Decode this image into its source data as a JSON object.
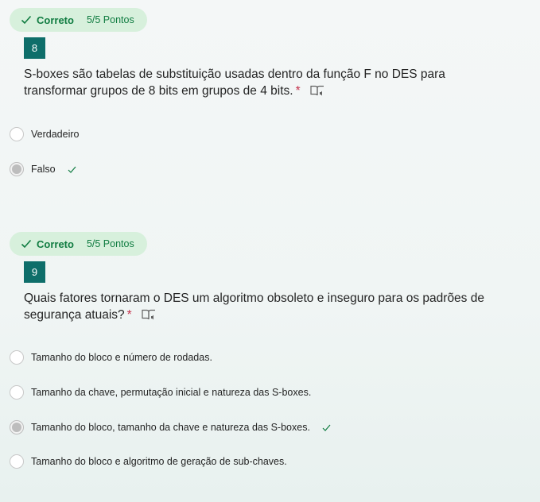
{
  "questions": [
    {
      "status": "Correto",
      "points": "5/5 Pontos",
      "number": "8",
      "text": "S-boxes são tabelas de substituição usadas dentro da função F no DES para transformar grupos de 8 bits em grupos de 4 bits.",
      "required_mark": "*",
      "options": [
        {
          "label": "Verdadeiro",
          "selected": false,
          "correct": false
        },
        {
          "label": "Falso",
          "selected": true,
          "correct": true
        }
      ]
    },
    {
      "status": "Correto",
      "points": "5/5 Pontos",
      "number": "9",
      "text": "Quais fatores tornaram o DES um algoritmo obsoleto e inseguro para os padrões de segurança atuais?",
      "required_mark": "*",
      "options": [
        {
          "label": "Tamanho do bloco e número de rodadas.",
          "selected": false,
          "correct": false
        },
        {
          "label": "Tamanho da chave, permutação inicial e natureza das S-boxes.",
          "selected": false,
          "correct": false
        },
        {
          "label": "Tamanho do bloco, tamanho da chave e natureza das S-boxes.",
          "selected": true,
          "correct": true
        },
        {
          "label": "Tamanho do bloco e algoritmo de geração de sub-chaves.",
          "selected": false,
          "correct": false
        }
      ]
    }
  ],
  "colors": {
    "correct_green": "#107c41",
    "badge_bg": "#d7f0dc",
    "number_bg": "#0e6e6a",
    "required_red": "#c4314b"
  },
  "icons": {
    "status": "checkmark-icon",
    "reader": "immersive-reader-icon",
    "correct_option": "checkmark-icon"
  }
}
